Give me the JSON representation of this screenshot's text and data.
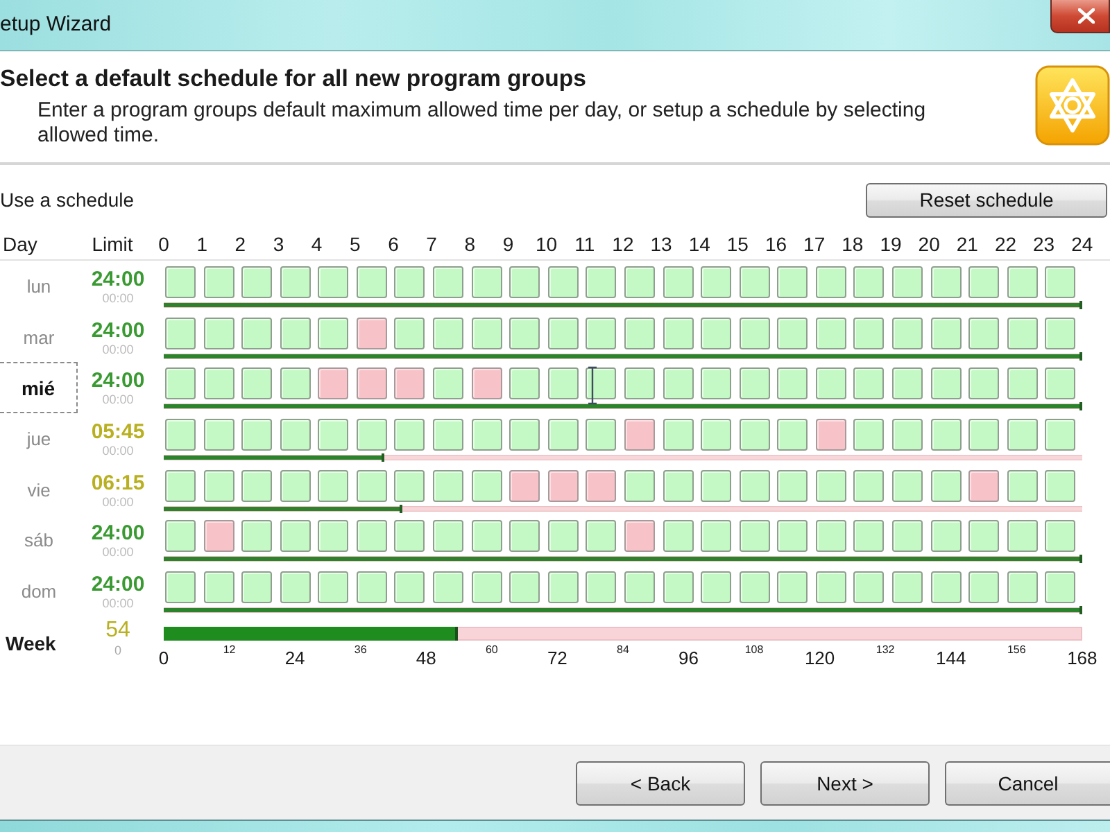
{
  "window": {
    "title": "etup Wizard"
  },
  "header": {
    "title": "Select a default schedule for all new program groups",
    "description": "Enter a program groups default maximum allowed time per day, or setup a schedule by selecting allowed time."
  },
  "schedule": {
    "label": "Use a schedule",
    "reset_button": "Reset schedule",
    "columns": {
      "day": "Day",
      "limit": "Limit"
    },
    "hours": [
      "0",
      "1",
      "2",
      "3",
      "4",
      "5",
      "6",
      "7",
      "8",
      "9",
      "10",
      "11",
      "12",
      "13",
      "14",
      "15",
      "16",
      "17",
      "18",
      "19",
      "20",
      "21",
      "22",
      "23",
      "24"
    ],
    "days": [
      {
        "name": "lun",
        "selected": false,
        "limit": "24:00",
        "used": "00:00",
        "level": 1,
        "allowed": [
          true,
          true,
          true,
          true,
          true,
          true,
          true,
          true,
          true,
          true,
          true,
          true,
          true,
          true,
          true,
          true,
          true,
          true,
          true,
          true,
          true,
          true,
          true,
          true
        ]
      },
      {
        "name": "mar",
        "selected": false,
        "limit": "24:00",
        "used": "00:00",
        "level": 1,
        "allowed": [
          true,
          true,
          true,
          true,
          true,
          false,
          true,
          true,
          true,
          true,
          true,
          true,
          true,
          true,
          true,
          true,
          true,
          true,
          true,
          true,
          true,
          true,
          true,
          true
        ]
      },
      {
        "name": "mié",
        "selected": true,
        "limit": "24:00",
        "used": "00:00",
        "level": 1,
        "allowed": [
          true,
          true,
          true,
          true,
          false,
          false,
          false,
          true,
          false,
          true,
          true,
          true,
          true,
          true,
          true,
          true,
          true,
          true,
          true,
          true,
          true,
          true,
          true,
          true
        ]
      },
      {
        "name": "jue",
        "selected": false,
        "limit": "05:45",
        "used": "00:00",
        "level": 0.2396,
        "allowed": [
          true,
          true,
          true,
          true,
          true,
          true,
          true,
          true,
          true,
          true,
          true,
          true,
          false,
          true,
          true,
          true,
          true,
          false,
          true,
          true,
          true,
          true,
          true,
          true
        ]
      },
      {
        "name": "vie",
        "selected": false,
        "limit": "06:15",
        "used": "00:00",
        "level": 0.2604,
        "allowed": [
          true,
          true,
          true,
          true,
          true,
          true,
          true,
          true,
          true,
          false,
          false,
          false,
          true,
          true,
          true,
          true,
          true,
          true,
          true,
          true,
          true,
          false,
          true,
          true
        ]
      },
      {
        "name": "sáb",
        "selected": false,
        "limit": "24:00",
        "used": "00:00",
        "level": 1,
        "allowed": [
          true,
          false,
          true,
          true,
          true,
          true,
          true,
          true,
          true,
          true,
          true,
          true,
          false,
          true,
          true,
          true,
          true,
          true,
          true,
          true,
          true,
          true,
          true,
          true
        ]
      },
      {
        "name": "dom",
        "selected": false,
        "limit": "24:00",
        "used": "00:00",
        "level": 1,
        "allowed": [
          true,
          true,
          true,
          true,
          true,
          true,
          true,
          true,
          true,
          true,
          true,
          true,
          true,
          true,
          true,
          true,
          true,
          true,
          true,
          true,
          true,
          true,
          true,
          true
        ]
      }
    ],
    "week": {
      "name": "Week",
      "limit": "54",
      "used": "0",
      "level": 0.3214,
      "scale": [
        "0",
        "12",
        "24",
        "36",
        "48",
        "60",
        "72",
        "84",
        "96",
        "108",
        "120",
        "132",
        "144",
        "156",
        "168"
      ]
    }
  },
  "buttons": [
    {
      "label": "< Back"
    },
    {
      "label": "Next >"
    },
    {
      "label": "Cancel"
    }
  ]
}
